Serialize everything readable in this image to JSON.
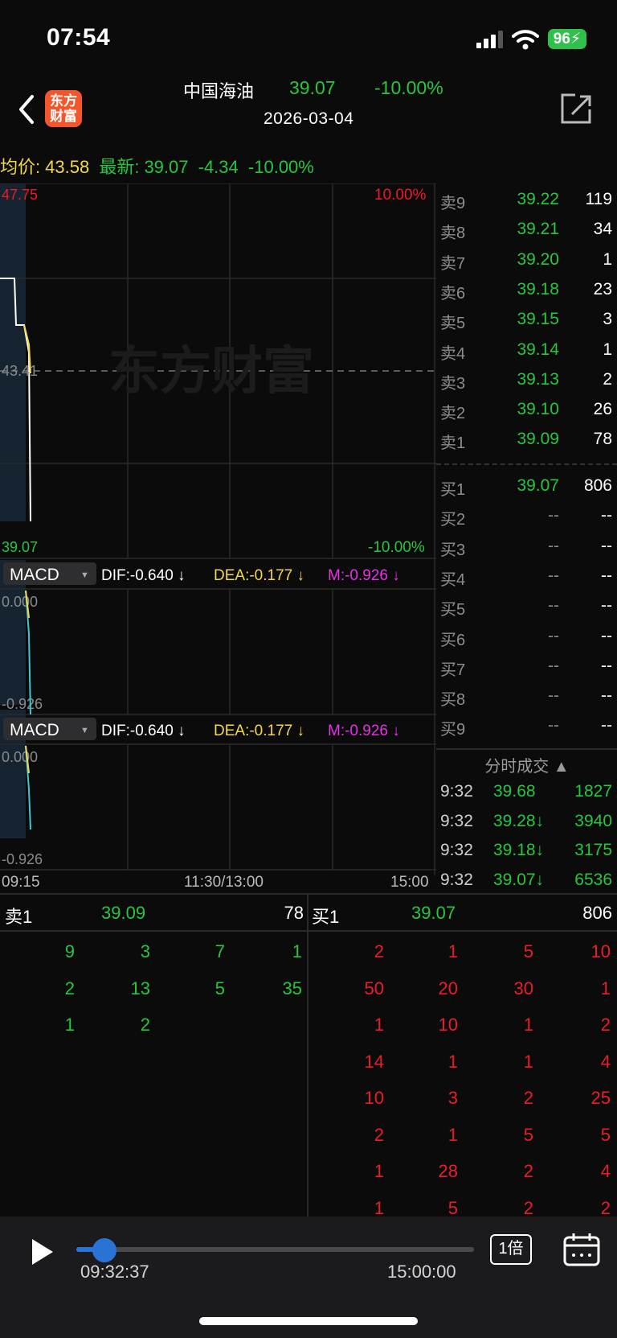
{
  "status_bar": {
    "time": "07:54",
    "battery": "96"
  },
  "nav": {
    "stock_name": "中国海油",
    "price": "39.07",
    "change_pct": "-10.00%",
    "date": "2026-03-04",
    "logo_text_line1": "东方",
    "logo_text_line2": "财富"
  },
  "summary": {
    "avg_label": "均价:",
    "avg_value": "43.58",
    "last_label": "最新:",
    "last_value": "39.07",
    "change": "-4.34",
    "change_pct": "-10.00%"
  },
  "chart": {
    "top_price": "47.75",
    "top_pct": "10.00%",
    "mid_price": "43.41",
    "bottom_price": "39.07",
    "bottom_pct": "-10.00%",
    "watermark": "东方财富",
    "time_start": "09:15",
    "time_mid": "11:30/13:00",
    "time_end": "15:00"
  },
  "indicators": [
    {
      "name": "MACD",
      "dif": "DIF:-0.640 ↓",
      "dea": "DEA:-0.177 ↓",
      "m": "M:-0.926 ↓",
      "top": "0.000",
      "bottom": "-0.926"
    },
    {
      "name": "MACD",
      "dif": "DIF:-0.640 ↓",
      "dea": "DEA:-0.177 ↓",
      "m": "M:-0.926 ↓",
      "top": "0.000",
      "bottom": "-0.926"
    }
  ],
  "asks": [
    {
      "label": "卖9",
      "price": "39.22",
      "vol": "119"
    },
    {
      "label": "卖8",
      "price": "39.21",
      "vol": "34"
    },
    {
      "label": "卖7",
      "price": "39.20",
      "vol": "1"
    },
    {
      "label": "卖6",
      "price": "39.18",
      "vol": "23"
    },
    {
      "label": "卖5",
      "price": "39.15",
      "vol": "3"
    },
    {
      "label": "卖4",
      "price": "39.14",
      "vol": "1"
    },
    {
      "label": "卖3",
      "price": "39.13",
      "vol": "2"
    },
    {
      "label": "卖2",
      "price": "39.10",
      "vol": "26"
    },
    {
      "label": "卖1",
      "price": "39.09",
      "vol": "78"
    }
  ],
  "bids": [
    {
      "label": "买1",
      "price": "39.07",
      "vol": "806"
    },
    {
      "label": "买2",
      "price": "--",
      "vol": "--"
    },
    {
      "label": "买3",
      "price": "--",
      "vol": "--"
    },
    {
      "label": "买4",
      "price": "--",
      "vol": "--"
    },
    {
      "label": "买5",
      "price": "--",
      "vol": "--"
    },
    {
      "label": "买6",
      "price": "--",
      "vol": "--"
    },
    {
      "label": "买7",
      "price": "--",
      "vol": "--"
    },
    {
      "label": "买8",
      "price": "--",
      "vol": "--"
    },
    {
      "label": "买9",
      "price": "--",
      "vol": "--"
    }
  ],
  "ticks_header": "分时成交 ▲",
  "ticks": [
    {
      "time": "9:32",
      "price": "39.68",
      "vol": "1827"
    },
    {
      "time": "9:32",
      "price": "39.28↓",
      "vol": "3940"
    },
    {
      "time": "9:32",
      "price": "39.18↓",
      "vol": "3175"
    },
    {
      "time": "9:32",
      "price": "39.07↓",
      "vol": "6536"
    }
  ],
  "book_bottom": {
    "sell_label": "卖1",
    "sell_price": "39.09",
    "sell_vol": "78",
    "buy_label": "买1",
    "buy_price": "39.07",
    "buy_vol": "806",
    "sell_queue": [
      [
        "9",
        "3",
        "7",
        "1"
      ],
      [
        "2",
        "13",
        "5",
        "35"
      ],
      [
        "1",
        "2",
        "",
        ""
      ]
    ],
    "buy_queue": [
      [
        "2",
        "1",
        "5",
        "10"
      ],
      [
        "50",
        "20",
        "30",
        "1"
      ],
      [
        "1",
        "10",
        "1",
        "2"
      ],
      [
        "14",
        "1",
        "1",
        "4"
      ],
      [
        "10",
        "3",
        "2",
        "25"
      ],
      [
        "2",
        "1",
        "5",
        "5"
      ],
      [
        "1",
        "28",
        "2",
        "4"
      ],
      [
        "1",
        "5",
        "2",
        "2"
      ]
    ]
  },
  "player": {
    "current_time": "09:32:37",
    "end_time": "15:00:00",
    "speed": "1倍",
    "progress": 0.07
  },
  "colors": {
    "up": "#ee1c25",
    "down": "#27c73b",
    "avg": "#f5d84a",
    "accent": "#2a73d6"
  }
}
